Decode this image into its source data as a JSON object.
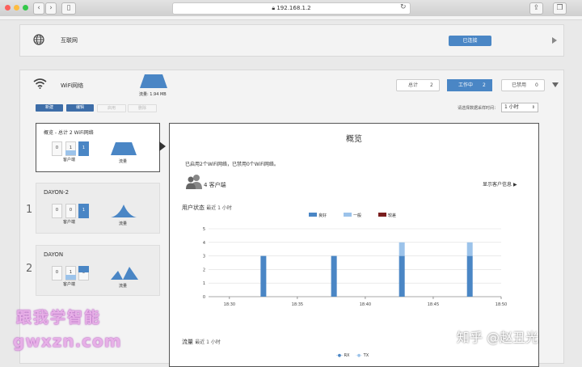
{
  "browser": {
    "url": "192.168.1.2",
    "tab_hint": ""
  },
  "internet": {
    "label": "互联网",
    "status_button": "已连接"
  },
  "wifi": {
    "label": "WiFi网络",
    "traffic": "流量: 1.94 MB",
    "total_label": "总计",
    "total_count": "2",
    "active_label": "工作中",
    "active_count": "2",
    "disabled_label": "已禁用",
    "disabled_count": "0",
    "toolbar": {
      "new": "新建",
      "edit": "编辑",
      "enable": "启用",
      "delete": "删除"
    },
    "sample_label": "请选择数据采样时间：",
    "sample_value": "1 小时"
  },
  "overview_card": {
    "title": "概览 - 总计 2 WiFi网络",
    "counts": [
      "0",
      "1",
      "1"
    ],
    "clients_label": "客户端",
    "traffic_label": "流量"
  },
  "networks": [
    {
      "index": "1",
      "name": "DAYON-2",
      "counts": [
        "0",
        "0",
        "1"
      ],
      "clients_label": "客户端",
      "traffic_label": "流量"
    },
    {
      "index": "2",
      "name": "DAYON",
      "counts": [
        "0",
        "1",
        "0"
      ],
      "clients_label": "客户端",
      "traffic_label": "流量"
    }
  ],
  "detail": {
    "title": "概览",
    "summary": "已启用2个WiFi网络，已禁用0个WiFi网络。",
    "clients": "4 客户端",
    "show_clients": "显示客户信息",
    "user_state_label": "用户状态",
    "user_state_range": "最近 1 小时",
    "traffic_label": "流量",
    "traffic_range": "最近 1 小时",
    "traffic_legend": [
      "RX",
      "TX"
    ]
  },
  "chart_data": {
    "type": "bar",
    "stacked": true,
    "x": [
      "18:30",
      "18:35",
      "18:40",
      "18:45",
      "18:50"
    ],
    "ylim": [
      0,
      5
    ],
    "yticks": [
      "0",
      "1",
      "2",
      "3",
      "4",
      "5"
    ],
    "legend_position": "top",
    "series": [
      {
        "name": "良好",
        "color": "#4a86c5",
        "points": [
          [
            2.8,
            3
          ],
          [
            4.15,
            3
          ],
          [
            5.45,
            3
          ],
          [
            6.75,
            3
          ]
        ]
      },
      {
        "name": "一般",
        "color": "#9cc3ea",
        "points": [
          [
            5.45,
            1
          ],
          [
            6.75,
            1
          ]
        ]
      },
      {
        "name": "较差",
        "color": "#7a1e1e",
        "points": []
      }
    ]
  },
  "watermark": {
    "left_line1": "跟我学智能",
    "left_line2": "gwxzn.com",
    "right": "知乎 @赵丑光"
  }
}
